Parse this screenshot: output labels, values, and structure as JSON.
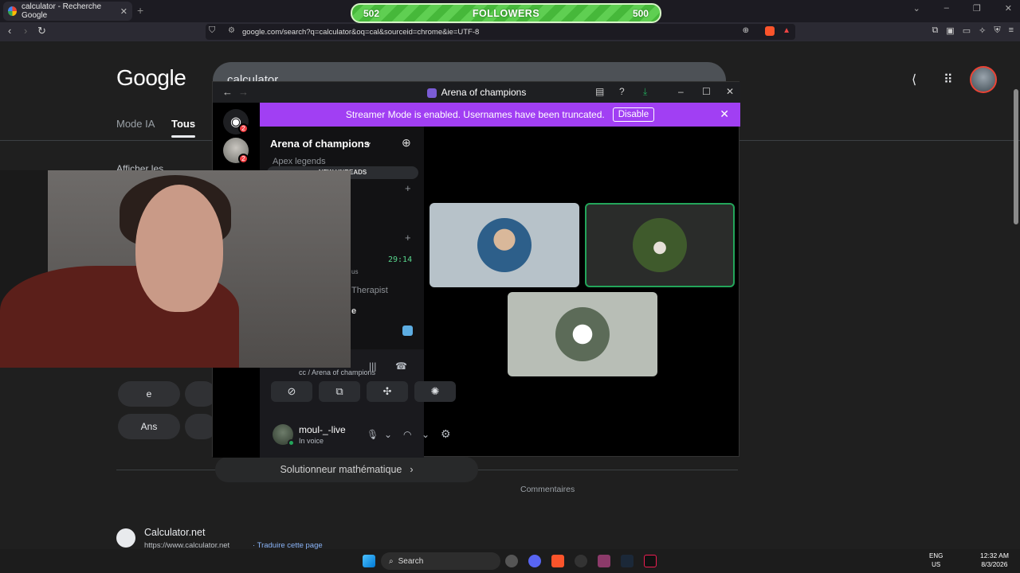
{
  "browser": {
    "tab_title": "calculator - Recherche Google",
    "tab_close": "✕",
    "new_tab": "+",
    "url": "google.com/search?q=calculator&oq=cal&sourceid=chrome&ie=UTF-8"
  },
  "followers": {
    "left": "502",
    "label": "FOLLOWERS",
    "right": "500"
  },
  "google": {
    "logo": "Google",
    "query": "calculator",
    "tabs": [
      "Mode IA",
      "Tous"
    ],
    "afficher": "Afficher les",
    "keys": [
      "e",
      "Ans"
    ],
    "solveur": "Solutionneur mathématique",
    "comments": "Commentaires",
    "result_title": "Calculator.net",
    "result_url": "https://www.calculator.net",
    "result_translate": "· Traduire cette page"
  },
  "discord": {
    "window_title": "Arena of champions",
    "streamer_msg": "Streamer Mode is enabled. Usernames have been truncated.",
    "disable_label": "Disable",
    "badge_count": "2",
    "server_name": "Arena of champions",
    "channel_faded": "Apex legends",
    "new_unreads": "NEW UNREADS",
    "timer": "29:14",
    "channel_us": "us",
    "therapist": "Therapist",
    "channel_e": "e",
    "voice_sub": "cc / Arena of champions",
    "username": "moul-_-live",
    "user_status": "In voice"
  },
  "taskbar": {
    "search": "Search",
    "lang1": "ENG",
    "lang2": "US",
    "time": "12:32 AM",
    "date": "8/3/2026"
  },
  "colors": {
    "discord_accent": "#a13ff3",
    "followers_green": "#46b83a",
    "speaking_green": "#23a55a"
  }
}
